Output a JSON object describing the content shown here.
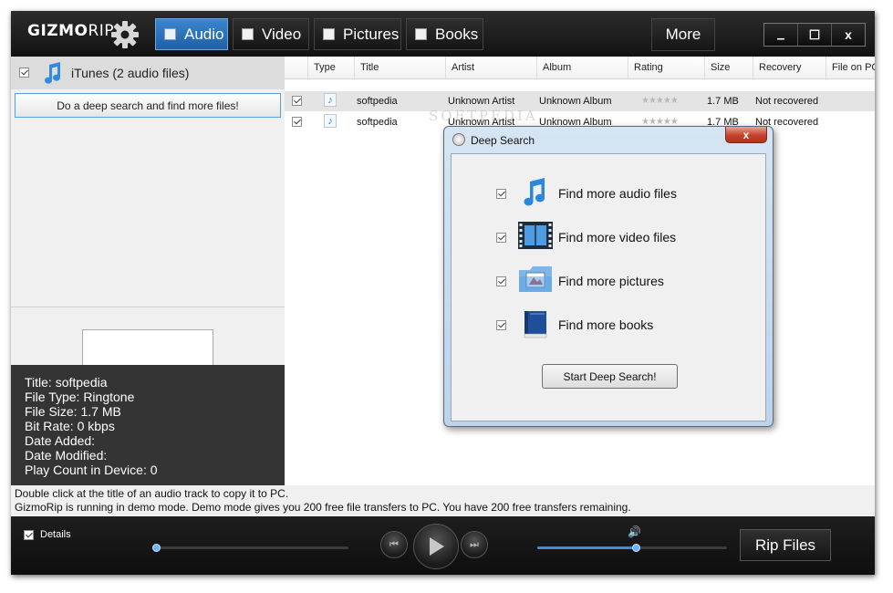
{
  "app": {
    "logo_main": "GIZMO",
    "logo_rip": "RIP",
    "tabs": [
      {
        "label": "Audio",
        "active": true
      },
      {
        "label": "Video",
        "active": false
      },
      {
        "label": "Pictures",
        "active": false
      },
      {
        "label": "Books",
        "active": false
      }
    ],
    "more_label": "More",
    "window_controls": {
      "minimize": "▁",
      "maximize": "☐",
      "close": "x"
    }
  },
  "left": {
    "source_label": "iTunes (2 audio files)",
    "deep_search_button": "Do a deep search and find more files!",
    "details": {
      "title": "Title: softpedia",
      "file_type": "File Type: Ringtone",
      "file_size": "File Size: 1.7 MB",
      "bit_rate": "Bit Rate: 0 kbps",
      "date_added": "Date Added:",
      "date_modified": "Date Modified:",
      "play_count": "Play Count in Device: 0"
    }
  },
  "table": {
    "headers": [
      "Type",
      "Title",
      "Artist",
      "Album",
      "Rating",
      "Size",
      "Recovery",
      "File on PC"
    ],
    "rows": [
      {
        "title": "softpedia",
        "artist": "Unknown Artist",
        "album": "Unknown Album",
        "rating": 0,
        "size": "1.7 MB",
        "recovery": "Not recovered",
        "selected": true
      },
      {
        "title": "softpedia",
        "artist": "Unknown Artist",
        "album": "Unknown Album",
        "rating": 0,
        "size": "1.7 MB",
        "recovery": "Not recovered",
        "selected": false
      }
    ],
    "watermark": "SOFTPEDIA"
  },
  "status": {
    "line1": "Double click at the title of an audio track to copy it to PC.",
    "line2": "GizmoRip is running in demo mode.  Demo mode gives you 200 free file transfers to PC.  You have 200 free transfers remaining."
  },
  "player": {
    "details_label": "Details",
    "rip_label": "Rip Files",
    "volume_level": 0.52
  },
  "dialog": {
    "title": "Deep Search",
    "close": "x",
    "options": [
      {
        "label": "Find more audio files",
        "icon": "music-note-icon",
        "checked": true
      },
      {
        "label": "Find more video files",
        "icon": "film-strip-icon",
        "checked": true
      },
      {
        "label": "Find more pictures",
        "icon": "picture-folder-icon",
        "checked": true
      },
      {
        "label": "Find more books",
        "icon": "book-icon",
        "checked": true
      }
    ],
    "start_button": "Start Deep Search!"
  },
  "colors": {
    "accent": "#2b72bd",
    "header_bg": "#1a1a1a",
    "panel_bg": "#f0f0f0"
  }
}
